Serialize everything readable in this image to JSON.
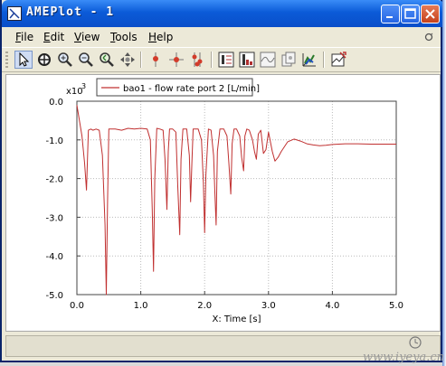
{
  "window": {
    "title": "AMEPlot - 1"
  },
  "menu": {
    "items": [
      "File",
      "Edit",
      "View",
      "Tools",
      "Help"
    ]
  },
  "toolbar": {
    "tools": [
      "select-icon",
      "zoom-fit-icon",
      "zoom-in-icon",
      "zoom-out-icon",
      "zoom-previous-icon",
      "pan-icon",
      "marker-icon",
      "crosshair-icon",
      "multi-marker-icon",
      "fft-icon",
      "histogram-icon",
      "filter-icon",
      "transform-icon",
      "3d-plot-icon",
      "export-icon"
    ]
  },
  "watermark": {
    "text": "www.iyeya.cn"
  },
  "chart_data": {
    "type": "line",
    "legend": {
      "entries": [
        "bao1 - flow rate port 2 [L/min]"
      ],
      "placement": "top"
    },
    "xlabel": "X: Time [s]",
    "ylabel": "",
    "y_multiplier": "x10",
    "y_multiplier_exp": "3",
    "xlim": [
      0.0,
      5.0
    ],
    "ylim": [
      -5.0,
      0.0
    ],
    "x_ticks": [
      "0.0",
      "1.0",
      "2.0",
      "3.0",
      "4.0",
      "5.0"
    ],
    "y_ticks": [
      "0.0",
      "-1.0",
      "-2.0",
      "-3.0",
      "-4.0",
      "-5.0"
    ],
    "grid": true,
    "color": "#c03030",
    "series": [
      {
        "name": "bao1 - flow rate port 2 [L/min]",
        "x": [
          0.0,
          0.02,
          0.05,
          0.08,
          0.12,
          0.15,
          0.18,
          0.22,
          0.25,
          0.3,
          0.35,
          0.4,
          0.44,
          0.46,
          0.48,
          0.5,
          0.55,
          0.6,
          0.7,
          0.8,
          0.9,
          1.0,
          1.1,
          1.15,
          1.18,
          1.2,
          1.22,
          1.25,
          1.3,
          1.35,
          1.38,
          1.41,
          1.43,
          1.45,
          1.5,
          1.55,
          1.58,
          1.61,
          1.63,
          1.66,
          1.72,
          1.76,
          1.78,
          1.8,
          1.82,
          1.86,
          1.9,
          1.95,
          1.98,
          2.0,
          2.02,
          2.06,
          2.1,
          2.14,
          2.16,
          2.18,
          2.2,
          2.24,
          2.3,
          2.35,
          2.38,
          2.41,
          2.43,
          2.46,
          2.5,
          2.55,
          2.58,
          2.61,
          2.63,
          2.66,
          2.7,
          2.75,
          2.78,
          2.81,
          2.84,
          2.88,
          2.92,
          2.96,
          3.0,
          3.03,
          3.06,
          3.1,
          3.15,
          3.2,
          3.3,
          3.4,
          3.5,
          3.6,
          3.7,
          3.8,
          3.9,
          4.0,
          4.2,
          4.4,
          4.6,
          4.8,
          5.0
        ],
        "y": [
          -0.1,
          -0.3,
          -0.6,
          -0.9,
          -1.6,
          -2.3,
          -0.75,
          -0.72,
          -0.75,
          -0.72,
          -0.75,
          -1.4,
          -3.2,
          -5.0,
          -2.6,
          -0.72,
          -0.72,
          -0.72,
          -0.75,
          -0.7,
          -0.72,
          -0.7,
          -0.72,
          -1.0,
          -2.8,
          -4.4,
          -2.0,
          -0.7,
          -0.72,
          -0.75,
          -1.5,
          -2.8,
          -1.3,
          -0.72,
          -0.72,
          -0.8,
          -2.2,
          -3.45,
          -1.5,
          -0.72,
          -0.72,
          -1.4,
          -2.6,
          -1.6,
          -0.72,
          -0.72,
          -0.72,
          -1.0,
          -2.1,
          -3.4,
          -1.9,
          -0.72,
          -0.75,
          -1.4,
          -2.35,
          -3.2,
          -1.3,
          -0.72,
          -0.72,
          -0.9,
          -1.6,
          -2.4,
          -1.1,
          -0.72,
          -0.72,
          -0.9,
          -1.45,
          -1.8,
          -0.9,
          -0.72,
          -0.75,
          -1.0,
          -1.3,
          -1.5,
          -0.85,
          -0.75,
          -1.35,
          -1.25,
          -0.8,
          -1.05,
          -1.3,
          -1.55,
          -1.45,
          -1.3,
          -1.05,
          -0.98,
          -1.03,
          -1.1,
          -1.13,
          -1.15,
          -1.14,
          -1.12,
          -1.1,
          -1.1,
          -1.11,
          -1.11,
          -1.11
        ]
      }
    ]
  }
}
